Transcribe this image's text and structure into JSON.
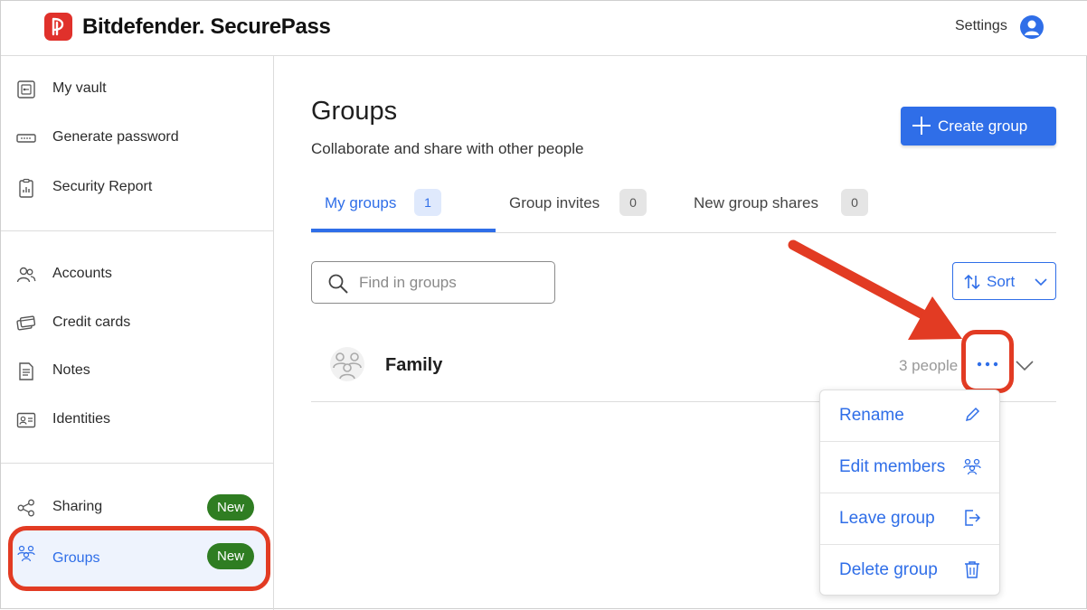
{
  "header": {
    "brand_name": "Bitdefender",
    "brand_product": "SecurePass",
    "settings_label": "Settings",
    "logo_icon": "securepass-logo-icon",
    "avatar_icon": "user-avatar-icon"
  },
  "sidebar": {
    "items": [
      {
        "label": "My vault",
        "icon": "vault-icon"
      },
      {
        "label": "Generate password",
        "icon": "password-field-icon"
      },
      {
        "label": "Security Report",
        "icon": "clipboard-report-icon"
      },
      {
        "label": "Accounts",
        "icon": "accounts-icon"
      },
      {
        "label": "Credit cards",
        "icon": "credit-cards-icon"
      },
      {
        "label": "Notes",
        "icon": "notes-icon"
      },
      {
        "label": "Identities",
        "icon": "identity-card-icon"
      },
      {
        "label": "Sharing",
        "icon": "share-icon",
        "badge": "New"
      },
      {
        "label": "Groups",
        "icon": "groups-icon",
        "badge": "New",
        "active": true
      }
    ]
  },
  "main": {
    "title": "Groups",
    "subtitle": "Collaborate and share with other people",
    "create_button": "Create group",
    "tabs": [
      {
        "label": "My groups",
        "count": "1",
        "active": true
      },
      {
        "label": "Group invites",
        "count": "0"
      },
      {
        "label": "New group shares",
        "count": "0"
      }
    ],
    "search": {
      "placeholder": "Find in groups",
      "value": ""
    },
    "sort_label": "Sort",
    "groups": [
      {
        "name": "Family",
        "members": "3 people"
      }
    ],
    "context_menu": [
      {
        "label": "Rename",
        "icon": "pencil-icon"
      },
      {
        "label": "Edit members",
        "icon": "edit-members-icon"
      },
      {
        "label": "Leave group",
        "icon": "leave-icon"
      },
      {
        "label": "Delete group",
        "icon": "trash-icon"
      }
    ]
  },
  "colors": {
    "accent": "#2f6ee8",
    "brand_red": "#e0312b",
    "new_badge": "#2f7d22",
    "annotation": "#e23b23"
  }
}
